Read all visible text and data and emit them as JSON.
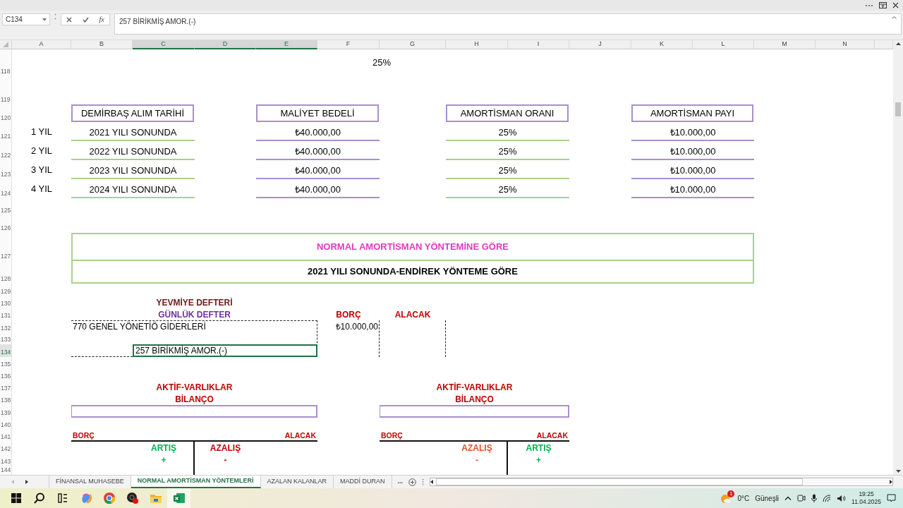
{
  "formula_bar": {
    "name_box": "C134",
    "function_label": "fx",
    "formula": "257 BİRİKMİŞ AMOR.(-)"
  },
  "columns": [
    {
      "label": "A",
      "selected": false
    },
    {
      "label": "B",
      "selected": false
    },
    {
      "label": "C",
      "selected": true
    },
    {
      "label": "D",
      "selected": true
    },
    {
      "label": "E",
      "selected": true
    },
    {
      "label": "F",
      "selected": false
    },
    {
      "label": "G",
      "selected": false
    },
    {
      "label": "H",
      "selected": false
    },
    {
      "label": "I",
      "selected": false
    },
    {
      "label": "J",
      "selected": false
    },
    {
      "label": "K",
      "selected": false
    },
    {
      "label": "L",
      "selected": false
    },
    {
      "label": "M",
      "selected": false
    },
    {
      "label": "N",
      "selected": false
    }
  ],
  "rows": [
    {
      "label": "118",
      "selected": false
    },
    {
      "label": "119",
      "selected": false
    },
    {
      "label": "120",
      "selected": false
    },
    {
      "label": "121",
      "selected": false
    },
    {
      "label": "122",
      "selected": false
    },
    {
      "label": "123",
      "selected": false
    },
    {
      "label": "124",
      "selected": false
    },
    {
      "label": "125",
      "selected": false
    },
    {
      "label": "126",
      "selected": false
    },
    {
      "label": "127",
      "selected": false
    },
    {
      "label": "128",
      "selected": false
    },
    {
      "label": "129",
      "selected": false
    },
    {
      "label": "130",
      "selected": false
    },
    {
      "label": "131",
      "selected": false
    },
    {
      "label": "132",
      "selected": false
    },
    {
      "label": "133",
      "selected": false
    },
    {
      "label": "134",
      "selected": true
    },
    {
      "label": "135",
      "selected": false
    },
    {
      "label": "136",
      "selected": false
    },
    {
      "label": "137",
      "selected": false
    },
    {
      "label": "138",
      "selected": false
    },
    {
      "label": "139",
      "selected": false
    },
    {
      "label": "140",
      "selected": false
    },
    {
      "label": "141",
      "selected": false
    },
    {
      "label": "142",
      "selected": false
    },
    {
      "label": "143",
      "selected": false
    },
    {
      "label": "144",
      "selected": false
    }
  ],
  "rate": "25%",
  "table": {
    "columns": [
      "DEMİRBAŞ ALIM TARİHİ",
      "MALİYET BEDELİ",
      "AMORTİSMAN ORANI",
      "AMORTİSMAN PAYI"
    ],
    "rows": [
      {
        "label": "1 YIL",
        "cells": [
          "2021 YILI SONUNDA",
          "₺40.000,00",
          "25%",
          "₺10.000,00"
        ]
      },
      {
        "label": "2 YIL",
        "cells": [
          "2022 YILI SONUNDA",
          "₺40.000,00",
          "25%",
          "₺10.000,00"
        ]
      },
      {
        "label": "3 YIL",
        "cells": [
          "2023 YILI SONUNDA",
          "₺40.000,00",
          "25%",
          "₺10.000,00"
        ]
      },
      {
        "label": "4 YIL",
        "cells": [
          "2024 YILI SONUNDA",
          "₺40.000,00",
          "25%",
          "₺10.000,00"
        ]
      }
    ]
  },
  "banner": {
    "title": "NORMAL AMORTİSMAN YÖNTEMİNE GÖRE",
    "subtitle": "2021 YILI SONUNDA-ENDİREK YÖNTEME GÖRE"
  },
  "journal": {
    "title": "YEVMİYE DEFTERİ",
    "subtitle": "GÜNLÜK DEFTER",
    "debit_label": "BORÇ",
    "credit_label": "ALACAK",
    "entries": [
      {
        "kind": "debit",
        "account": "770 GENEL YÖNETİÖ GİDERLERİ",
        "amount": "₺10.000,00",
        "active": false
      },
      {
        "kind": "credit",
        "account": "257 BİRİKMİŞ AMOR.(-)",
        "active": true
      }
    ]
  },
  "t_accounts": [
    {
      "title": "AKTİF-VARLIKLAR",
      "subtitle": "BİLANÇO",
      "debit_label": "BORÇ",
      "credit_label": "ALACAK",
      "sides": [
        {
          "label": "ARTIŞ",
          "sign": "+",
          "color": "#00b050"
        },
        {
          "label": "AZALIŞ",
          "sign": "-",
          "color": "#c00000"
        }
      ]
    },
    {
      "title": "AKTİF-VARLIKLAR",
      "subtitle": "BİLANÇO",
      "debit_label": "BORÇ",
      "credit_label": "ALACAK",
      "sides": [
        {
          "label": "AZALIŞ",
          "sign": "-",
          "color": "#e0502a"
        },
        {
          "label": "ARTIŞ",
          "sign": "+",
          "color": "#00b050"
        }
      ]
    }
  ],
  "sheet_tabs": [
    {
      "label": "FİNANSAL MUHASEBE",
      "selected": false
    },
    {
      "label": "NORMAL AMORTİSMAN YÖNTEMLERİ",
      "selected": true
    },
    {
      "label": "AZALAN KALANLAR",
      "selected": false
    },
    {
      "label": "MADDİ DURAN",
      "selected": false
    }
  ],
  "more_tabs": "...",
  "taskbar": {
    "weather_badge": "1",
    "temperature": "0°C",
    "weather": "Güneşli",
    "time": "19:25",
    "date": "11.04.2025"
  }
}
